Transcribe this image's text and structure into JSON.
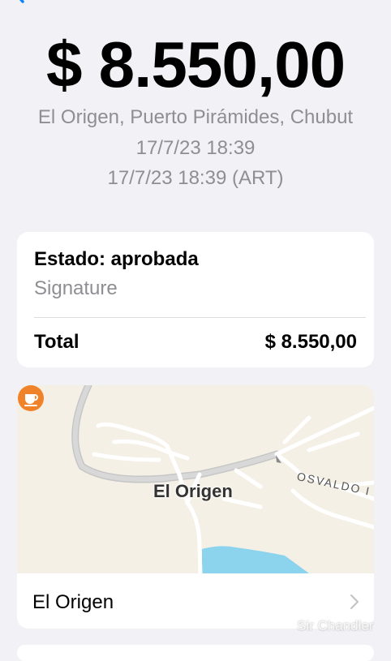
{
  "transaction": {
    "amount": "$ 8.550,00",
    "merchant_location": "El Origen, Puerto Pirámides, Chubut",
    "date_local": "17/7/23 18:39",
    "date_with_tz": "17/7/23 18:39 (ART)"
  },
  "status_card": {
    "status": "Estado: aprobada",
    "subtitle": "Signature",
    "total_label": "Total",
    "total_value": "$ 8.550,00"
  },
  "map": {
    "place_label": "El Origen",
    "street_label": "OSVALDO I",
    "pin_icon": "coffee-cup-icon",
    "pin_color": "#f0822a",
    "water_color": "#8cd3ee"
  },
  "place_row": {
    "name": "El Origen"
  },
  "watermark": "Sir Chandler",
  "colors": {
    "accent": "#0a84ff",
    "secondary_text": "#8e8e93",
    "background": "#f2f1f6"
  }
}
